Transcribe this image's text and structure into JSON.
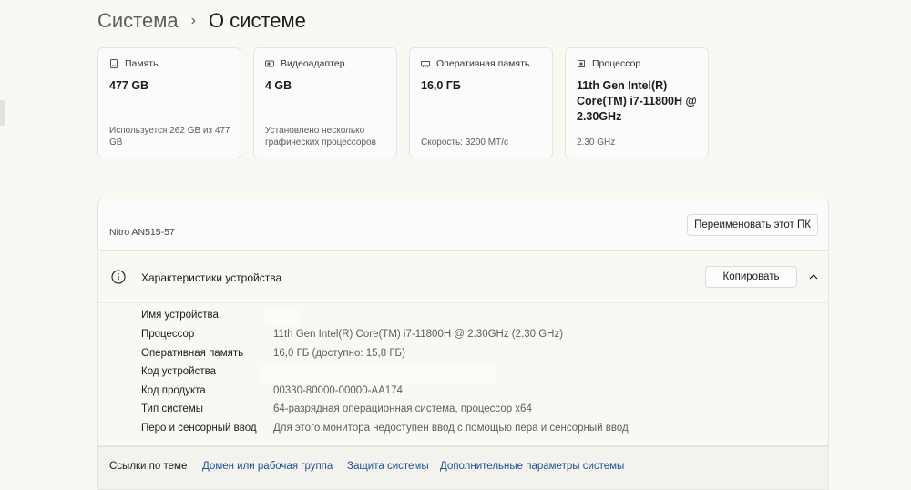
{
  "breadcrumb": {
    "parent": "Система",
    "separator": "›",
    "current": "О системе"
  },
  "cards": [
    {
      "title": "Память",
      "value": "477 GB",
      "sub": "Используется 262 GB из 477 GB"
    },
    {
      "title": "Видеоадаптер",
      "value": "4 GB",
      "sub": "Установлено несколько графических процессоров"
    },
    {
      "title": "Оперативная память",
      "value": "16,0 ГБ",
      "sub": "Скорость: 3200 MT/c"
    },
    {
      "title": "Процессор",
      "value": "11th Gen Intel(R) Core(TM) i7-11800H @ 2.30GHz",
      "sub": "2.30 GHz"
    }
  ],
  "device": {
    "name": "Nitro AN515-57",
    "rename_label": "Переименовать этот ПК"
  },
  "specs": {
    "title": "Характеристики устройства",
    "copy_label": "Копировать",
    "rows": [
      {
        "label": "Имя устройства",
        "value": ""
      },
      {
        "label": "Процессор",
        "value": "11th Gen Intel(R) Core(TM) i7-11800H @ 2.30GHz (2.30 GHz)"
      },
      {
        "label": "Оперативная память",
        "value": "16,0 ГБ (доступно: 15,8 ГБ)"
      },
      {
        "label": "Код устройства",
        "value": ""
      },
      {
        "label": "Код продукта",
        "value": "00330-80000-00000-AA174"
      },
      {
        "label": "Тип системы",
        "value": "64-разрядная операционная система, процессор x64"
      },
      {
        "label": "Перо и сенсорный ввод",
        "value": "Для этого монитора недоступен ввод с помощью пера и сенсорный ввод"
      }
    ]
  },
  "links": {
    "label": "Ссылки по теме",
    "items": [
      "Домен или рабочая группа",
      "Защита системы",
      "Дополнительные параметры системы"
    ]
  },
  "colors": {
    "background": "#f9f8f2",
    "link": "#1f4f9a",
    "muted": "#5d5d5d"
  }
}
